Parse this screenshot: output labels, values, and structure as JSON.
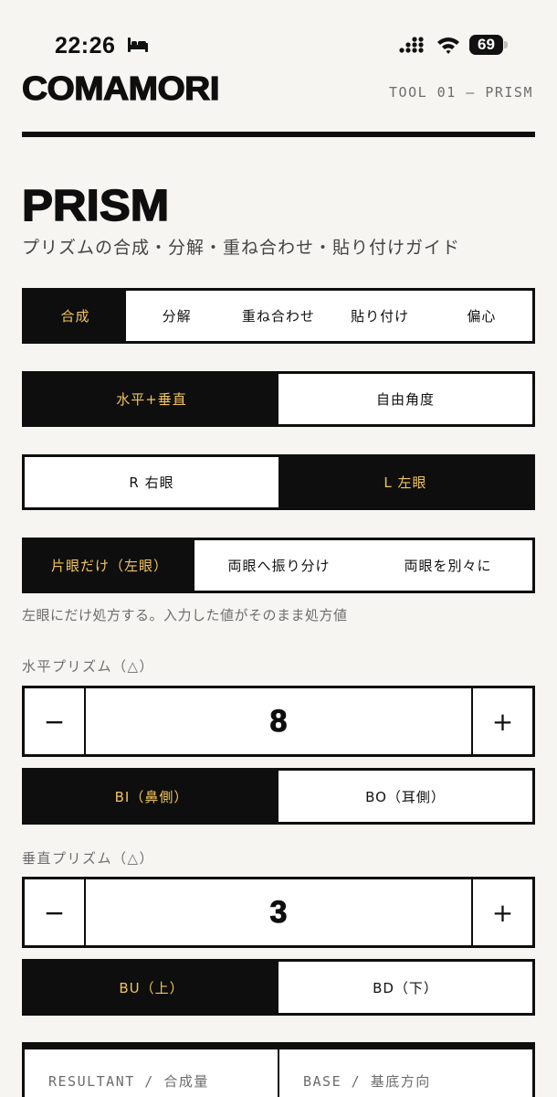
{
  "status_bar": {
    "time": "22:26",
    "battery": "69",
    "icons": [
      "bed-icon",
      "signal-icon",
      "wifi-icon",
      "battery-icon"
    ]
  },
  "header": {
    "brand": "COMAMORI",
    "tool_label": "TOOL 01 — PRISM"
  },
  "page": {
    "title": "PRISM",
    "subtitle": "プリズムの合成・分解・重ね合わせ・貼り付けガイド"
  },
  "mode_tabs": {
    "items": [
      "合成",
      "分解",
      "重ね合わせ",
      "貼り付け",
      "偏心"
    ],
    "selected": 0
  },
  "input_mode": {
    "items": [
      "水平+垂直",
      "自由角度"
    ],
    "selected": 0
  },
  "eye_select": {
    "items": [
      "R 右眼",
      "L 左眼"
    ],
    "selected": 1
  },
  "distribution": {
    "items": [
      "片眼だけ（左眼）",
      "両眼へ振り分け",
      "両眼を別々に"
    ],
    "selected": 0,
    "hint": "左眼にだけ処方する。入力した値がそのまま処方値"
  },
  "horizontal": {
    "label": "水平プリズム（△）",
    "minus": "−",
    "value": "8",
    "plus": "+",
    "base_items": [
      "BI（鼻側）",
      "BO（耳側）"
    ],
    "base_selected": 0
  },
  "vertical": {
    "label": "垂直プリズム（△）",
    "minus": "−",
    "value": "3",
    "plus": "+",
    "base_items": [
      "BU（上）",
      "BD（下）"
    ],
    "base_selected": 0
  },
  "result": {
    "resultant_label": "RESULTANT / 合成量",
    "base_label": "BASE / 基底方向"
  },
  "colors": {
    "background": "#f7f5f1",
    "ink": "#0e0e0e",
    "accent": "#f2c45a",
    "muted": "#6d6d6d"
  }
}
